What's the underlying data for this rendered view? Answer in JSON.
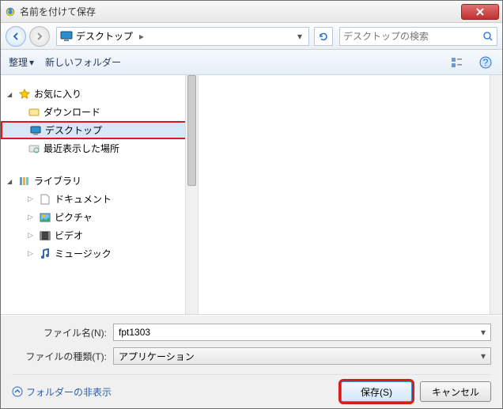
{
  "title": "名前を付けて保存",
  "breadcrumb": {
    "location": "デスクトップ"
  },
  "search": {
    "placeholder": "デスクトップの検索"
  },
  "toolbar": {
    "organize": "整理",
    "newfolder": "新しいフォルダー"
  },
  "tree": {
    "favorites": {
      "label": "お気に入り",
      "items": [
        "ダウンロード",
        "デスクトップ",
        "最近表示した場所"
      ]
    },
    "libraries": {
      "label": "ライブラリ",
      "items": [
        "ドキュメント",
        "ピクチャ",
        "ビデオ",
        "ミュージック"
      ]
    },
    "selected_index": 1
  },
  "filename": {
    "label": "ファイル名(N):",
    "value": "fpt1303"
  },
  "filetype": {
    "label": "ファイルの種類(T):",
    "value": "アプリケーション"
  },
  "hide_folders": "フォルダーの非表示",
  "buttons": {
    "save": "保存(S)",
    "cancel": "キャンセル"
  }
}
